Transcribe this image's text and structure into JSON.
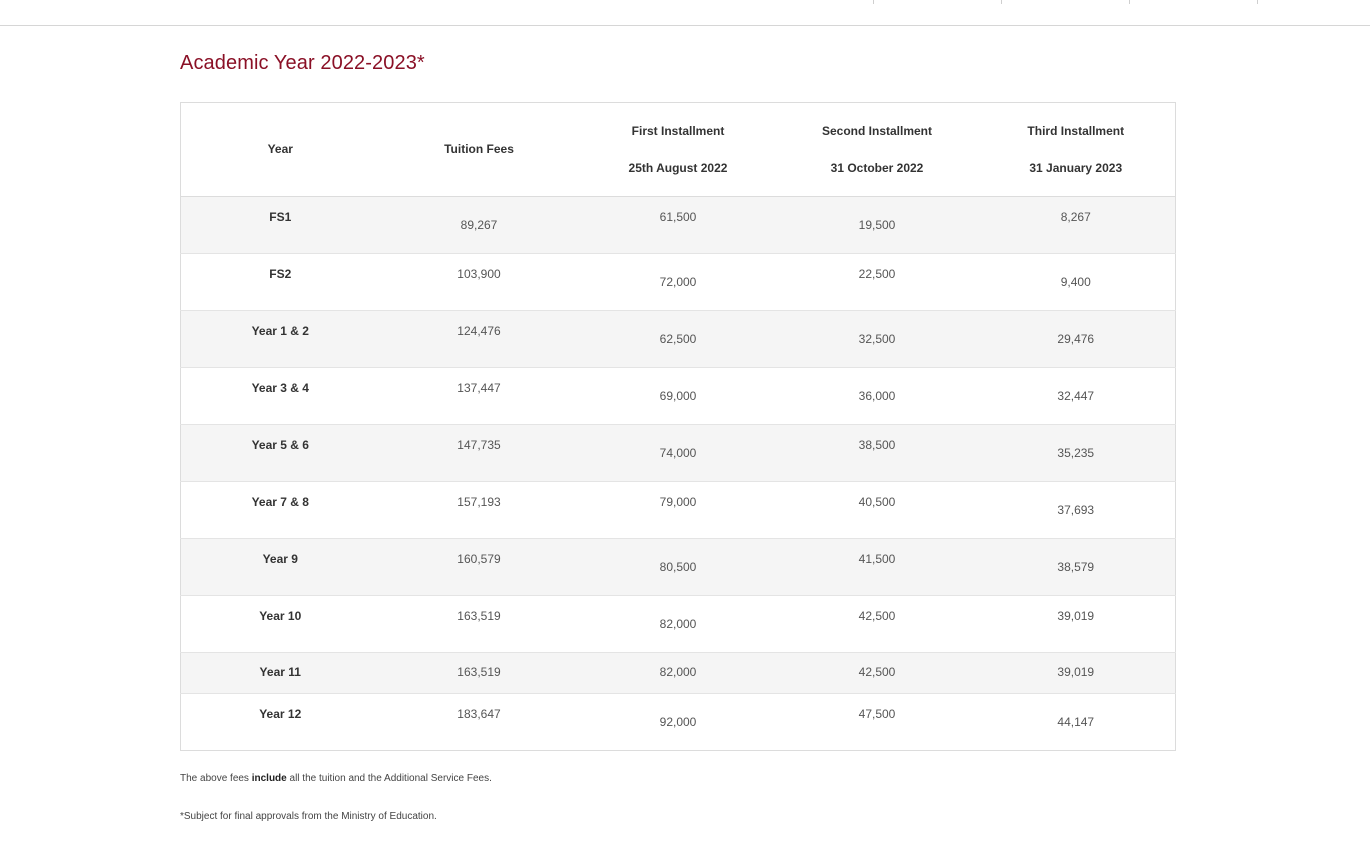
{
  "page": {
    "title": "Academic Year 2022-2023*"
  },
  "table": {
    "headers": {
      "year": "Year",
      "tuition": "Tuition Fees",
      "first": "First Installment",
      "first_date": "25th August 2022",
      "second": "Second Installment",
      "second_date": "31 October 2022",
      "third": "Third Installment",
      "third_date": "31 January 2023"
    },
    "rows": [
      {
        "year": "FS1",
        "tuition": "89,267",
        "first": "61,500",
        "second": "19,500",
        "third": "8,267"
      },
      {
        "year": "FS2",
        "tuition": "103,900",
        "first": "72,000",
        "second": "22,500",
        "third": "9,400"
      },
      {
        "year": "Year 1 & 2",
        "tuition": "124,476",
        "first": "62,500",
        "second": "32,500",
        "third": "29,476"
      },
      {
        "year": "Year 3 & 4",
        "tuition": "137,447",
        "first": "69,000",
        "second": "36,000",
        "third": "32,447"
      },
      {
        "year": "Year 5 & 6",
        "tuition": "147,735",
        "first": "74,000",
        "second": "38,500",
        "third": "35,235"
      },
      {
        "year": "Year 7 & 8",
        "tuition": "157,193",
        "first": "79,000",
        "second": "40,500",
        "third": "37,693"
      },
      {
        "year": "Year 9",
        "tuition": "160,579",
        "first": "80,500",
        "second": "41,500",
        "third": "38,579"
      },
      {
        "year": "Year 10",
        "tuition": "163,519",
        "first": "82,000",
        "second": "42,500",
        "third": "39,019"
      },
      {
        "year": "Year 11",
        "tuition": "163,519",
        "first": "82,000",
        "second": "42,500",
        "third": "39,019"
      },
      {
        "year": "Year 12",
        "tuition": "183,647",
        "first": "92,000",
        "second": "47,500",
        "third": "44,147"
      }
    ]
  },
  "notes": {
    "fees_prefix": "The above fees ",
    "fees_bold": "include",
    "fees_suffix": " all the tuition and the Additional Service Fees.",
    "approval": "*Subject for final approvals from the Ministry of Education."
  },
  "colors": {
    "title": "#8a1026",
    "row_alt": "#f5f5f5",
    "border": "#dcdcdc"
  }
}
